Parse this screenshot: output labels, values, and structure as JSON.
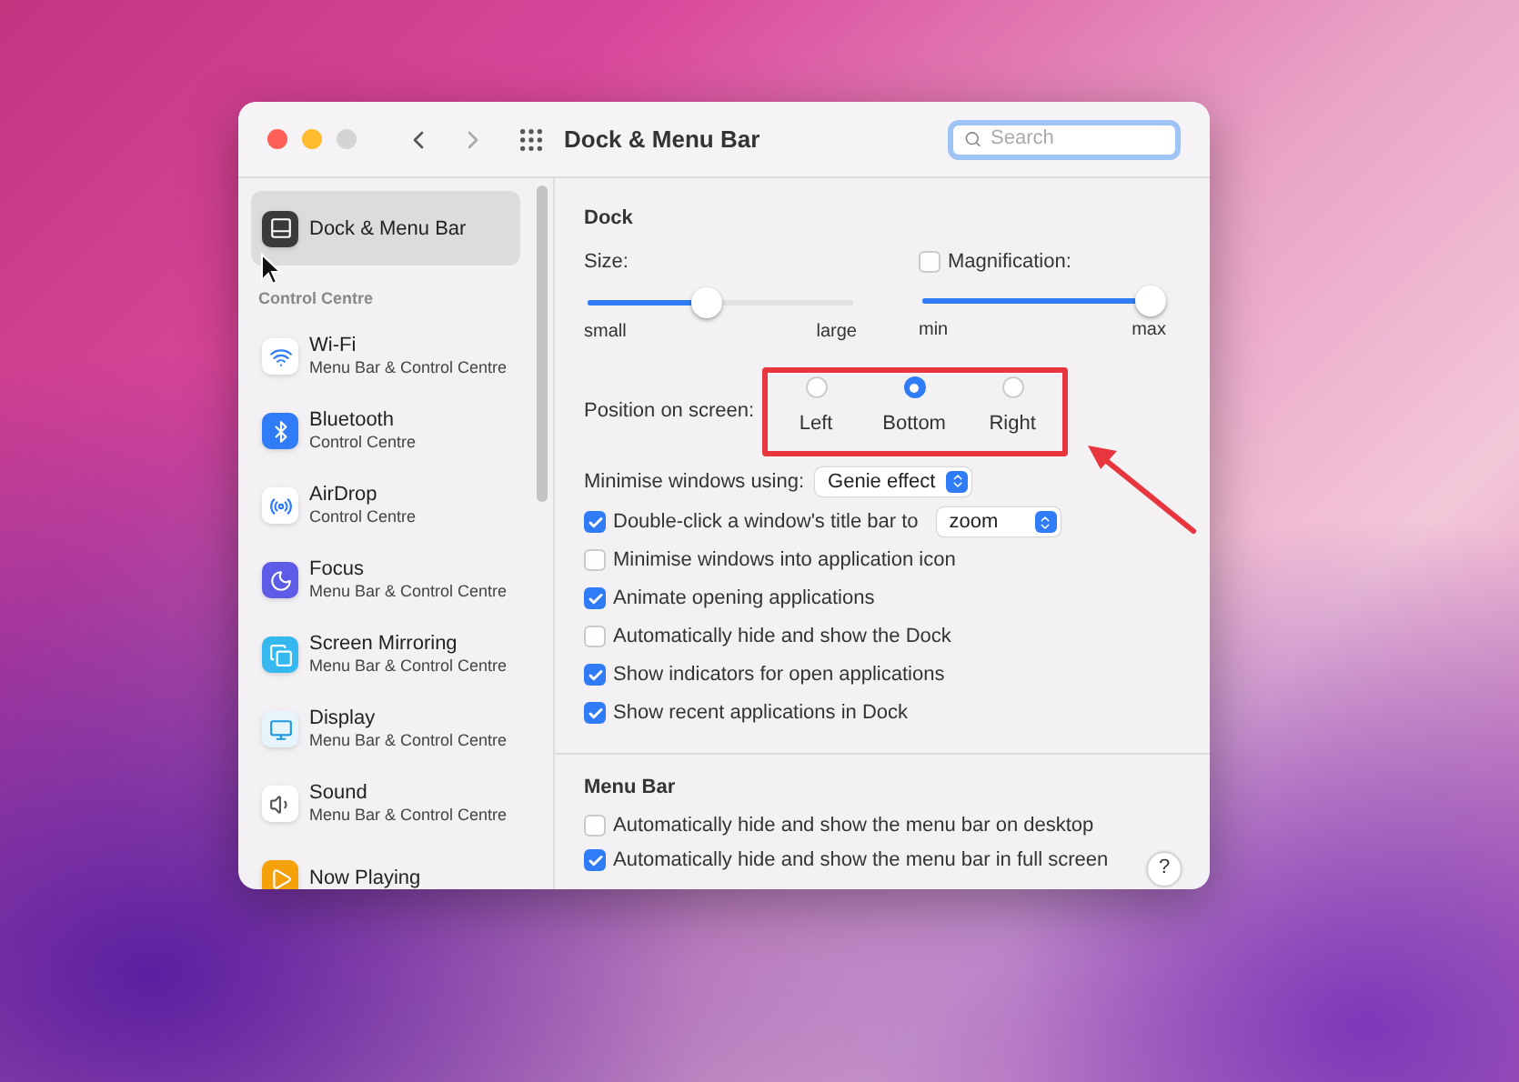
{
  "window": {
    "title": "Dock & Menu Bar",
    "search": {
      "placeholder": "Search"
    }
  },
  "sidebar": {
    "top_items": [
      {
        "label": "Dock & Menu Bar",
        "selected": true
      }
    ],
    "section": {
      "title": "Control Centre",
      "items": [
        {
          "label": "Wi-Fi",
          "subtitle": "Menu Bar & Control Centre",
          "selected": false
        },
        {
          "label": "Bluetooth",
          "subtitle": "Control Centre",
          "selected": false
        },
        {
          "label": "AirDrop",
          "subtitle": "Control Centre",
          "selected": false
        },
        {
          "label": "Focus",
          "subtitle": "Menu Bar & Control Centre",
          "selected": false
        },
        {
          "label": "Screen Mirroring",
          "subtitle": "Menu Bar & Control Centre",
          "selected": false
        },
        {
          "label": "Display",
          "subtitle": "Menu Bar & Control Centre",
          "selected": false
        },
        {
          "label": "Sound",
          "subtitle": "Menu Bar & Control Centre",
          "selected": false
        },
        {
          "label": "Now Playing",
          "selected": false
        }
      ]
    }
  },
  "dock": {
    "heading": "Dock",
    "size": {
      "label": "Size:",
      "level": 0.44,
      "min_label": "small",
      "max_label": "large"
    },
    "magnification": {
      "label": "Magnification:",
      "checked": false,
      "level": 1,
      "min_label": "min",
      "max_label": "max"
    },
    "position": {
      "label": "Position on screen:",
      "options": [
        {
          "label": "Left",
          "selected": false
        },
        {
          "label": "Bottom",
          "selected": true
        },
        {
          "label": "Right",
          "selected": false
        }
      ]
    },
    "minimise": {
      "label": "Minimise windows using:",
      "value": "Genie effect"
    },
    "options": [
      {
        "kind": "select",
        "label": "Double-click a window's title bar to",
        "checked": true,
        "value": "zoom"
      },
      {
        "kind": "checkbox",
        "label": "Minimise windows into application icon",
        "checked": false
      },
      {
        "kind": "checkbox",
        "label": "Animate opening applications",
        "checked": true
      },
      {
        "kind": "checkbox",
        "label": "Automatically hide and show the Dock",
        "checked": false
      },
      {
        "kind": "checkbox",
        "label": "Show indicators for open applications",
        "checked": true
      },
      {
        "kind": "checkbox",
        "label": "Show recent applications in Dock",
        "checked": true
      }
    ]
  },
  "menu_bar": {
    "heading": "Menu Bar",
    "options": [
      {
        "label": "Automatically hide and show the menu bar on desktop",
        "checked": false
      },
      {
        "label": "Automatically hide and show the menu bar in full screen",
        "checked": true
      }
    ]
  },
  "help_button": "?"
}
